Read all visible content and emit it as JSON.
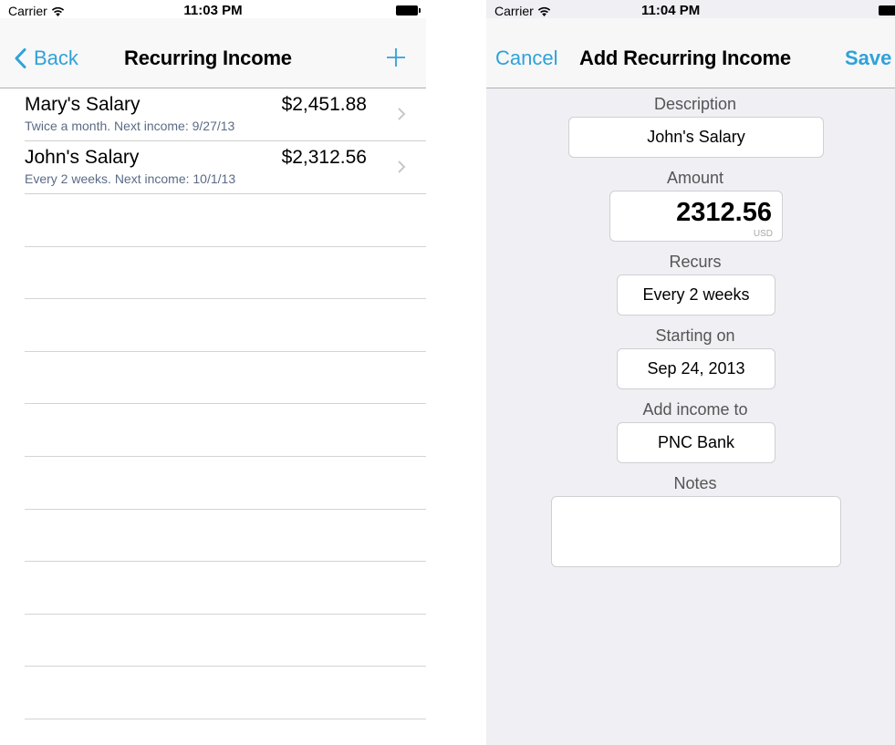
{
  "left": {
    "status": {
      "carrier": "Carrier",
      "time": "11:03 PM"
    },
    "nav": {
      "back_label": "Back",
      "title": "Recurring Income"
    },
    "incomes": [
      {
        "name": "Mary's Salary",
        "amount": "$2,451.88",
        "detail": "Twice a month. Next income: 9/27/13"
      },
      {
        "name": "John's Salary",
        "amount": "$2,312.56",
        "detail": "Every 2 weeks. Next income: 10/1/13"
      }
    ]
  },
  "right": {
    "status": {
      "carrier": "Carrier",
      "time": "11:04 PM"
    },
    "nav": {
      "cancel_label": "Cancel",
      "title": "Add Recurring Income",
      "save_label": "Save"
    },
    "form": {
      "description": {
        "label": "Description",
        "value": "John's Salary"
      },
      "amount": {
        "label": "Amount",
        "value": "2312.56",
        "currency": "USD"
      },
      "recurs": {
        "label": "Recurs",
        "value": "Every 2 weeks"
      },
      "starting_on": {
        "label": "Starting on",
        "value": "Sep 24, 2013"
      },
      "add_income_to": {
        "label": "Add income to",
        "value": "PNC Bank"
      },
      "notes": {
        "label": "Notes",
        "value": ""
      }
    }
  },
  "colors": {
    "accent": "#2fa2d9",
    "subtitle": "#5b6b86",
    "form_background": "#efeff4"
  }
}
